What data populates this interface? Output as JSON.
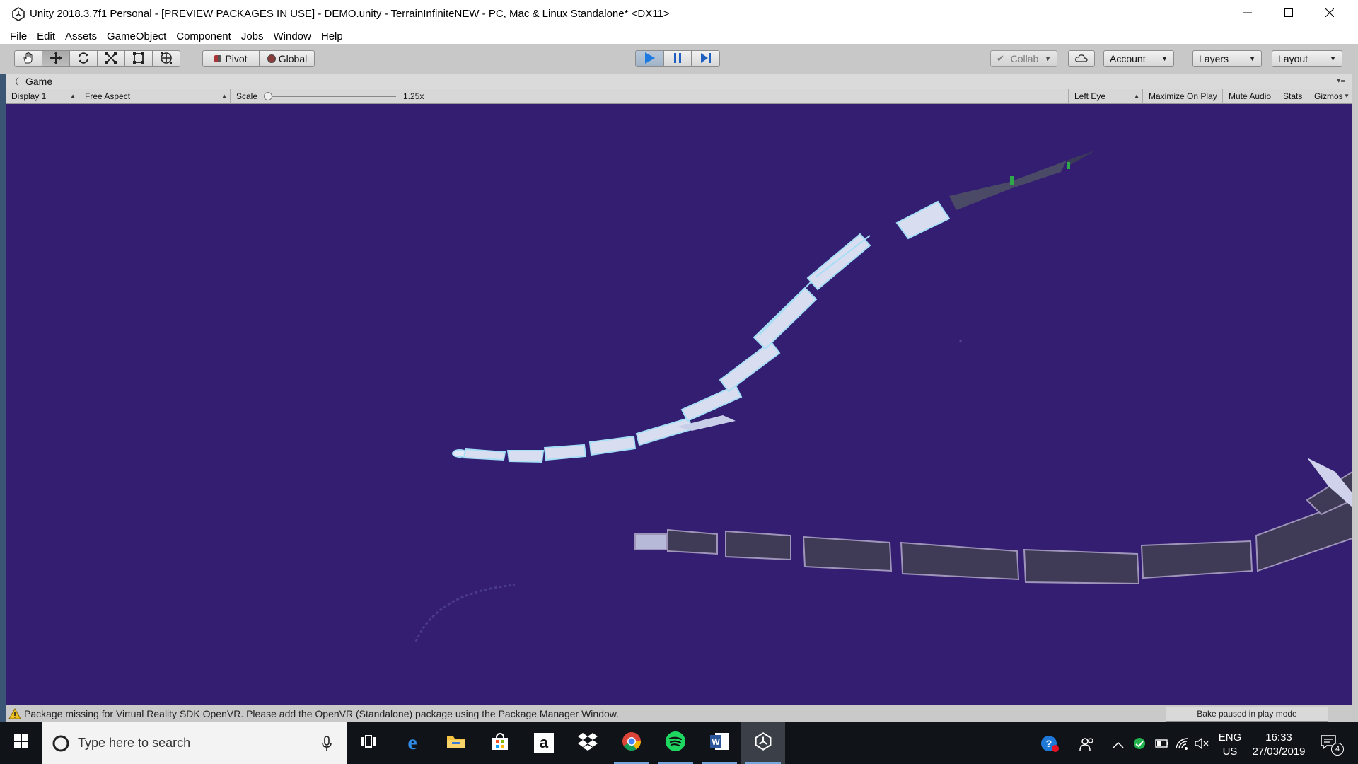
{
  "window": {
    "title": "Unity 2018.3.7f1 Personal - [PREVIEW PACKAGES IN USE] - DEMO.unity - TerrainInfiniteNEW - PC, Mac & Linux Standalone* <DX11>",
    "minimize_icon": "minimize-icon",
    "maximize_icon": "maximize-icon",
    "close_icon": "close-icon"
  },
  "menu": [
    "File",
    "Edit",
    "Assets",
    "GameObject",
    "Component",
    "Jobs",
    "Window",
    "Help"
  ],
  "toolbar": {
    "tools": [
      "hand-tool-icon",
      "move-tool-icon",
      "rotate-tool-icon",
      "scale-tool-icon",
      "rect-tool-icon",
      "transform-tool-icon"
    ],
    "active_tool": "move-tool-icon",
    "pivot_label": "Pivot",
    "global_label": "Global",
    "play_state": "playing",
    "collab_label": "Collab",
    "account_label": "Account",
    "layers_label": "Layers",
    "layout_label": "Layout"
  },
  "game": {
    "tab_label": "Game",
    "display": "Display 1",
    "aspect": "Free Aspect",
    "scale_label": "Scale",
    "scale_value": "1.25x",
    "scale_fraction": 0.02,
    "eye": "Left Eye",
    "maximize_on_play": "Maximize On Play",
    "mute_audio": "Mute Audio",
    "stats": "Stats",
    "gizmos": "Gizmos",
    "background_color": "#331e72"
  },
  "status": {
    "message": "Package missing for Virtual Reality SDK OpenVR. Please add the OpenVR (Standalone) package using the Package Manager Window.",
    "bake": "Bake paused in play mode"
  },
  "taskbar": {
    "search_placeholder": "Type here to search",
    "apps": [
      "task-view-icon",
      "edge-icon",
      "file-explorer-icon",
      "store-icon",
      "amazon-icon",
      "dropbox-icon",
      "chrome-icon",
      "spotify-icon",
      "word-icon",
      "unity-icon"
    ],
    "active_app": "unity-icon",
    "lang_top": "ENG",
    "lang_bottom": "US",
    "time": "16:33",
    "date": "27/03/2019",
    "notification_count": "4"
  },
  "colors": {
    "viewport": "#331e72",
    "play_active": "#1e7ae0",
    "taskbar": "#101318"
  }
}
